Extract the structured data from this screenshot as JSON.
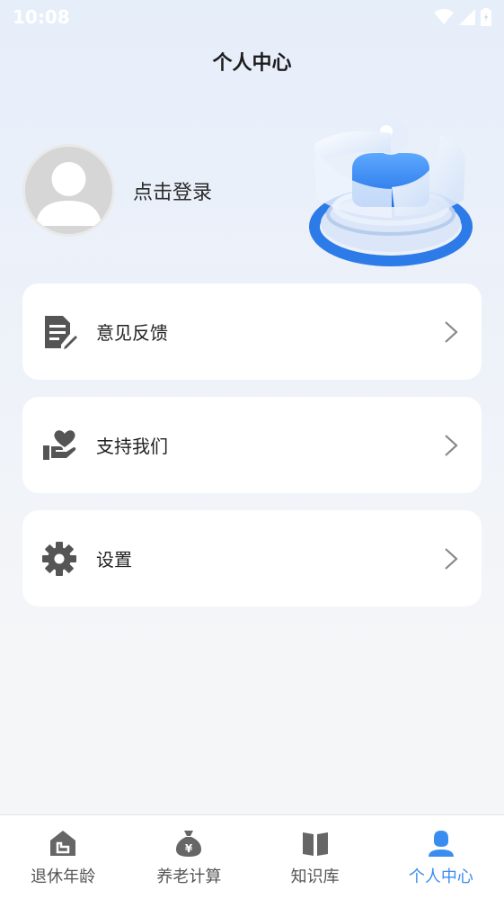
{
  "status_bar": {
    "time": "10:08"
  },
  "header": {
    "title": "个人中心"
  },
  "profile": {
    "login_text": "点击登录"
  },
  "menu": [
    {
      "label": "意见反馈",
      "icon": "feedback-doc-icon"
    },
    {
      "label": "支持我们",
      "icon": "heart-hand-icon"
    },
    {
      "label": "设置",
      "icon": "gear-icon"
    }
  ],
  "tabbar": {
    "items": [
      {
        "label": "退休年龄",
        "icon": "home-icon"
      },
      {
        "label": "养老计算",
        "icon": "money-bag-icon"
      },
      {
        "label": "知识库",
        "icon": "book-icon"
      },
      {
        "label": "个人中心",
        "icon": "person-icon"
      }
    ],
    "active_index": 3
  },
  "colors": {
    "accent": "#3a8df0",
    "icon_gray": "#555555",
    "card_bg": "#ffffff"
  }
}
